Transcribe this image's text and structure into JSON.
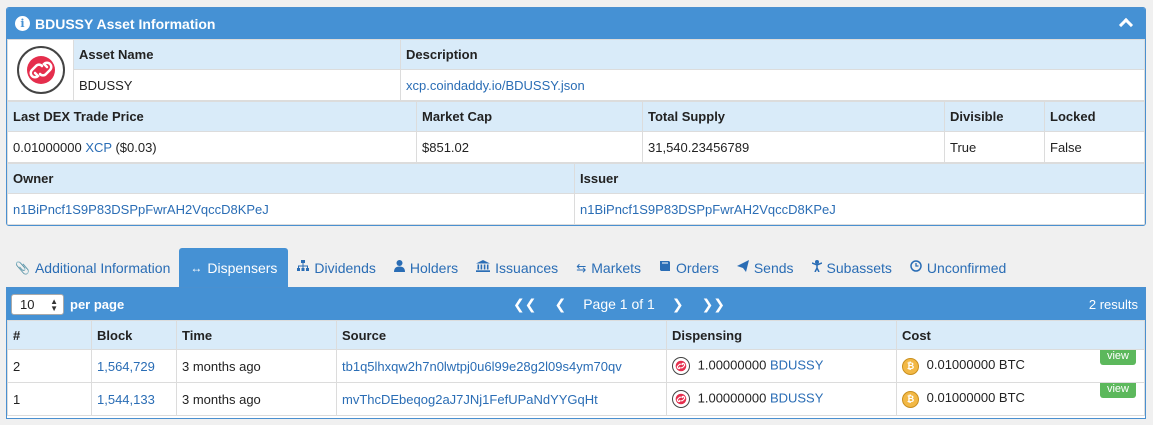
{
  "asset_panel": {
    "title": "BDUSSY Asset Information",
    "asset_name_label": "Asset Name",
    "asset_name": "BDUSSY",
    "description_label": "Description",
    "description": "xcp.coindaddy.io/BDUSSY.json",
    "last_price_label": "Last DEX Trade Price",
    "last_price_value": "0.01000000",
    "last_price_unit": "XCP",
    "last_price_usd": "($0.03)",
    "market_cap_label": "Market Cap",
    "market_cap": "$851.02",
    "total_supply_label": "Total Supply",
    "total_supply": "31,540.23456789",
    "divisible_label": "Divisible",
    "divisible": "True",
    "locked_label": "Locked",
    "locked": "False",
    "owner_label": "Owner",
    "owner": "n1BiPncf1S9P83DSPpFwrAH2VqccD8KPeJ",
    "issuer_label": "Issuer",
    "issuer": "n1BiPncf1S9P83DSPpFwrAH2VqccD8KPeJ"
  },
  "tabs": [
    {
      "label": "Additional Information",
      "icon": "paperclip-icon"
    },
    {
      "label": "Dispensers",
      "icon": "arrows-horizontal-icon"
    },
    {
      "label": "Dividends",
      "icon": "sitemap-icon"
    },
    {
      "label": "Holders",
      "icon": "user-icon"
    },
    {
      "label": "Issuances",
      "icon": "bank-icon"
    },
    {
      "label": "Markets",
      "icon": "exchange-icon"
    },
    {
      "label": "Orders",
      "icon": "book-icon"
    },
    {
      "label": "Sends",
      "icon": "paper-plane-icon"
    },
    {
      "label": "Subassets",
      "icon": "child-icon"
    },
    {
      "label": "Unconfirmed",
      "icon": "clock-icon"
    }
  ],
  "active_tab": "Dispensers",
  "dispensers": {
    "per_page_value": "10",
    "per_page_label": "per page",
    "page_text": "Page 1 of 1",
    "results": "2 results",
    "columns": [
      "#",
      "Block",
      "Time",
      "Source",
      "Dispensing",
      "Cost"
    ],
    "rows": [
      {
        "num": "2",
        "block": "1,564,729",
        "time": "3 months ago",
        "source": "tb1q5lhxqw2h7n0lwtpj0u6l99e28g2l09s4ym70qv",
        "disp_amount": "1.00000000",
        "disp_asset": "BDUSSY",
        "cost": "0.01000000 BTC",
        "action": "view"
      },
      {
        "num": "1",
        "block": "1,544,133",
        "time": "3 months ago",
        "source": "mvThcDEbeqog2aJ7JNj1FefUPaNdYYGqHt",
        "disp_amount": "1.00000000",
        "disp_asset": "BDUSSY",
        "cost": "0.01000000 BTC",
        "action": "view"
      }
    ]
  },
  "colors": {
    "header_blue": "#4591d4",
    "row_header": "#d9ebf9",
    "link": "#2a6db5",
    "view_button": "#5cb85c"
  }
}
